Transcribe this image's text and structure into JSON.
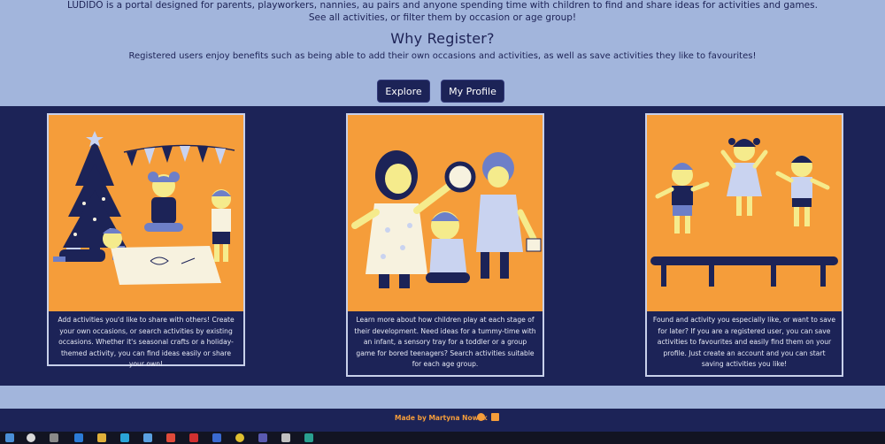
{
  "hero": {
    "intro_line1": "LUDIDO is a portal designed for parents, playworkers, nannies, au pairs and anyone spending time with children to find and share ideas for activities and games.",
    "intro_line2": "See all activities, or filter them by occasion or age group!",
    "why_title": "Why Register?",
    "register_text": "Registered users enjoy benefits such as being able to add their own occasions and activities, as well as save activities they like to favourites!",
    "explore_label": "Explore",
    "profile_label": "My Profile"
  },
  "cards": [
    {
      "text": "Add activities you'd like to share with others! Create your own occasions, or search activities by existing occasions. Whether it's seasonal crafts or a holiday-themed activity, you can find ideas easily or share your own!"
    },
    {
      "text": "Learn more about how children play at each stage of their development. Need ideas for a tummy-time with an infant, a sensory tray for a toddler or a group game for bored teenagers? Search activities suitable for each age group."
    },
    {
      "text": "Found and activity you especially like, or want to save for later? If you are a registered user, you can save activities to favourites and easily find them on your profile. Just create an account and you can start saving activities you like!"
    }
  ],
  "footer": {
    "made_by": "Made by Martyna Nowak"
  },
  "colors": {
    "navy": "#1c2357",
    "periwinkle": "#a2b5dc",
    "orange": "#f59d3a"
  }
}
